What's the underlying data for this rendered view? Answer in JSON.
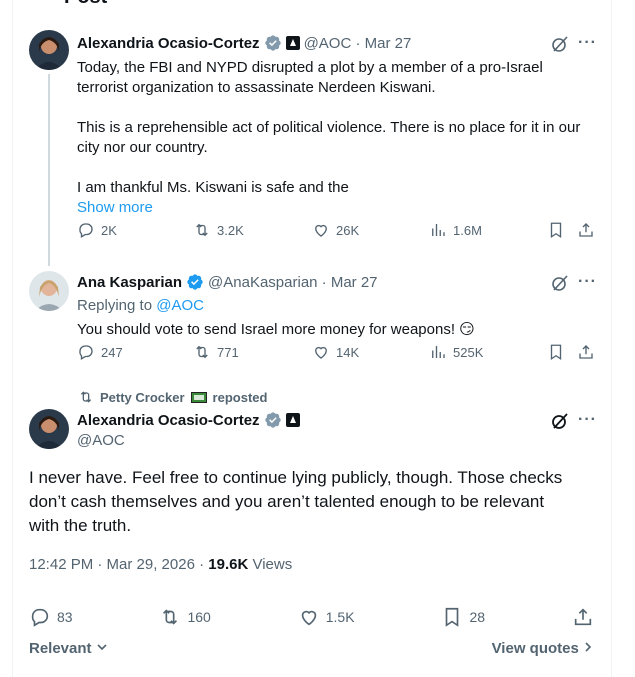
{
  "header": {
    "title": "Post"
  },
  "quoted_tweet": {
    "author_name": "Alexandria Ocasio-Cortez",
    "handle_date": "@AOC · Mar 27",
    "line1": "Today, the FBI and NYPD disrupted a plot by a member of a pro-Israel",
    "line2": "terrorist organization to assassinate Nerdeen Kiswani.",
    "line3": "This is a reprehensible act of political violence. There is no place for it in our",
    "line4": "city nor our country.",
    "line5": "I am thankful Ms. Kiswani is safe and the",
    "show_more": "Show more",
    "replies": "2K",
    "reposts": "3.2K",
    "likes": "26K",
    "views": "1.6M"
  },
  "reply_tweet": {
    "author_name": "Ana Kasparian",
    "handle_date": "@AnaKasparian · Mar 27",
    "replying_prefix": "Replying to",
    "replying_handle": "@AOC",
    "text": "You should vote to send Israel more money for weapons! 😏",
    "replies": "247",
    "reposts": "771",
    "likes": "14K",
    "views": "525K"
  },
  "repost_banner": {
    "user": "Petty Crocker",
    "label": "reposted"
  },
  "main_tweet": {
    "author_name": "Alexandria Ocasio-Cortez",
    "handle": "@AOC",
    "line1": "I never have. Feel free to continue lying publicly, though. Those checks",
    "line2": "don’t cash themselves and you aren’t talented enough to be relevant",
    "line3": "with the truth.",
    "timestamp": "12:42 PM · Mar 29, 2026 ·",
    "views_count": "19.6K",
    "views_label": "Views",
    "replies": "83",
    "reposts": "160",
    "likes": "1.5K",
    "bookmarks": "28"
  },
  "footer": {
    "sort_label": "Relevant",
    "view_quotes": "View quotes"
  },
  "colors": {
    "accent": "#1d9bf0",
    "muted": "#536471",
    "text": "#0f1419"
  }
}
